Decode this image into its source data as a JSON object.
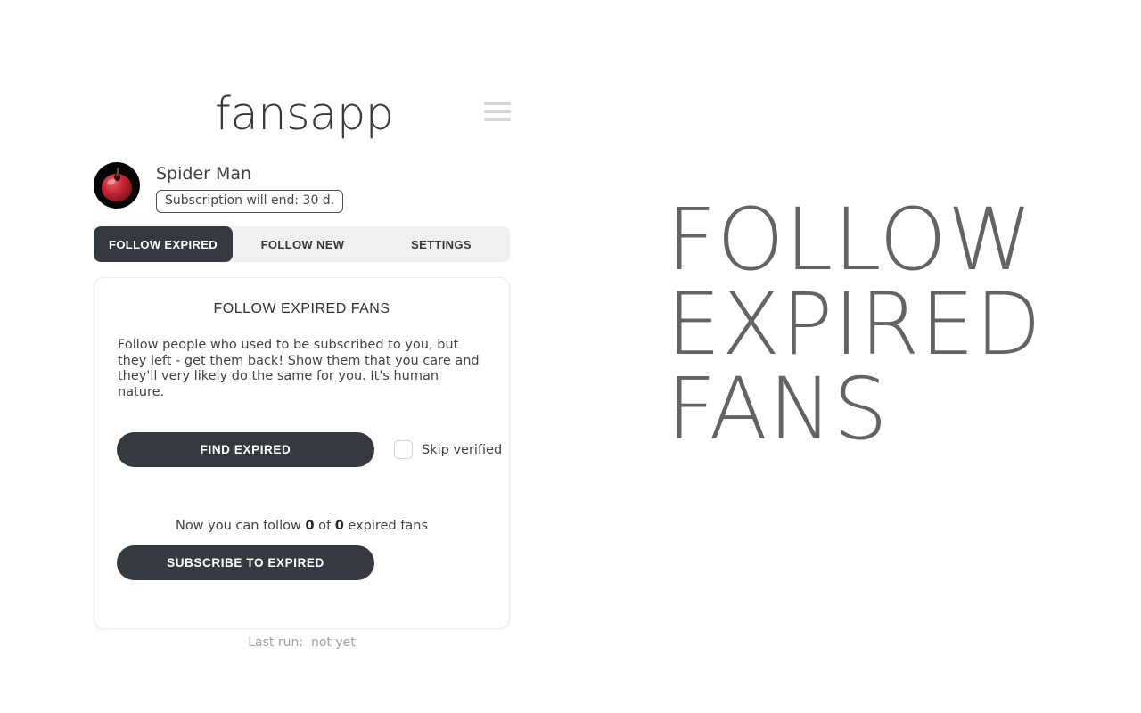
{
  "app": {
    "logo": "fansapp",
    "menu_icon": "hamburger-menu-icon"
  },
  "profile": {
    "name": "Spider Man",
    "subscription_badge": "Subscription will end: 30 d.",
    "avatar_icon": "apple-avatar"
  },
  "tabs": [
    {
      "label": "FOLLOW EXPIRED",
      "active": true
    },
    {
      "label": "FOLLOW NEW",
      "active": false
    },
    {
      "label": "SETTINGS",
      "active": false
    }
  ],
  "card": {
    "title": "FOLLOW EXPIRED FANS",
    "description": "Follow people who used to be subscribed to you, but they left - get them back! Show them that you care and they'll very likely do the same for you. It's human nature.",
    "find_button_label": "FIND EXPIRED",
    "skip_verified_label": "Skip verified",
    "skip_verified_checked": false,
    "status_prefix": "Now you can follow ",
    "status_count_current": "0",
    "status_middle": " of ",
    "status_count_total": "0",
    "status_suffix": " expired fans",
    "subscribe_button_label": "SUBSCRIBE TO EXPIRED",
    "last_run_label": "Last run:",
    "last_run_value": "not yet"
  },
  "hero": {
    "heading_line1": "FOLLOW",
    "heading_line2": "EXPIRED",
    "heading_line3": "FANS"
  },
  "colors": {
    "dark": "#343a40",
    "tab_bar_bg": "#f0f0f0",
    "hero_text": "#636363",
    "muted": "#9aa1a8"
  }
}
